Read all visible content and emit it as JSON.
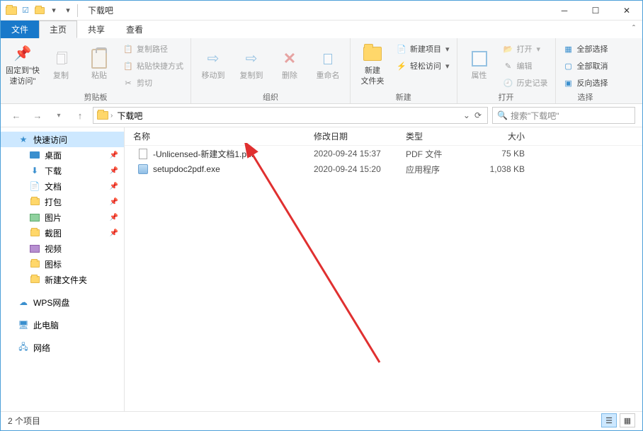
{
  "window": {
    "title": "下载吧"
  },
  "tabs": {
    "file": "文件",
    "home": "主页",
    "share": "共享",
    "view": "查看"
  },
  "ribbon": {
    "clipboard": {
      "pin": "固定到\"快\n速访问\"",
      "copy": "复制",
      "paste": "粘贴",
      "copypath": "复制路径",
      "pasteshortcut": "粘贴快捷方式",
      "cut": "剪切",
      "group": "剪贴板"
    },
    "organize": {
      "moveto": "移动到",
      "copyto": "复制到",
      "delete": "删除",
      "rename": "重命名",
      "group": "组织"
    },
    "new": {
      "newfolder": "新建\n文件夹",
      "newitem": "新建项目",
      "easyaccess": "轻松访问",
      "group": "新建"
    },
    "open": {
      "properties": "属性",
      "open": "打开",
      "edit": "编辑",
      "history": "历史记录",
      "group": "打开"
    },
    "select": {
      "selectall": "全部选择",
      "selectnone": "全部取消",
      "invert": "反向选择",
      "group": "选择"
    }
  },
  "breadcrumb": {
    "current": "下载吧"
  },
  "search": {
    "placeholder": "搜索\"下载吧\""
  },
  "columns": {
    "name": "名称",
    "date": "修改日期",
    "type": "类型",
    "size": "大小"
  },
  "sidebar": {
    "quickaccess": "快速访问",
    "desktop": "桌面",
    "downloads": "下载",
    "documents": "文档",
    "dabao": "打包",
    "pictures": "图片",
    "jietu": "截图",
    "videos": "视频",
    "icons": "图标",
    "newfolder": "新建文件夹",
    "wpscloud": "WPS网盘",
    "thispc": "此电脑",
    "network": "网络"
  },
  "files": [
    {
      "name": "-Unlicensed-新建文档1.pdf",
      "date": "2020-09-24 15:37",
      "type": "PDF 文件",
      "size": "75 KB",
      "icon": "pdf"
    },
    {
      "name": "setupdoc2pdf.exe",
      "date": "2020-09-24 15:20",
      "type": "应用程序",
      "size": "1,038 KB",
      "icon": "exe"
    }
  ],
  "status": {
    "count": "2 个项目"
  }
}
